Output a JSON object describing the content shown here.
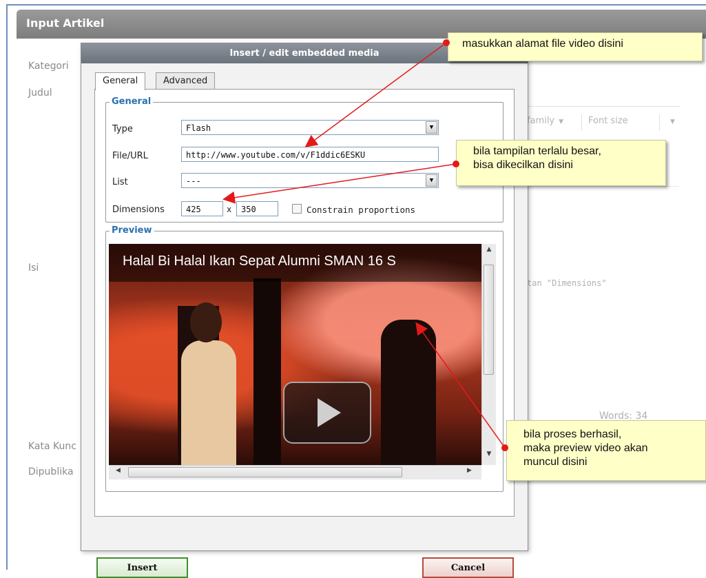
{
  "panel": {
    "title": "Input Artikel"
  },
  "form_labels": {
    "kategori": "Kategori",
    "judul": "Judul",
    "isi": "Isi",
    "kata_kunci": "Kata Kunc",
    "dipublikasi": "Dipublika"
  },
  "editor": {
    "font_family": "family",
    "font_size": "Font size",
    "hint_text": "tan \"Dimensions\"",
    "word_count": "Words: 34"
  },
  "dialog": {
    "title": "Insert / edit embedded media",
    "tabs": [
      {
        "label": "General",
        "active": true
      },
      {
        "label": "Advanced",
        "active": false
      }
    ],
    "general": {
      "legend": "General",
      "type_label": "Type",
      "type_value": "Flash",
      "file_label": "File/URL",
      "file_value": "http://www.youtube.com/v/F1ddic6ESKU",
      "list_label": "List",
      "list_value": "---",
      "dimensions_label": "Dimensions",
      "width_value": "425",
      "times": "x",
      "height_value": "350",
      "constrain_label": "Constrain proportions",
      "constrain_checked": false
    },
    "preview": {
      "legend": "Preview",
      "video_title": "Halal Bi Halal Ikan Sepat Alumni SMAN 16 S"
    },
    "buttons": {
      "insert": "Insert",
      "cancel": "Cancel"
    }
  },
  "annotations": {
    "file_url_note": "masukkan alamat file video disini",
    "dimensions_note": [
      "bila tampilan terlalu besar,",
      "bisa dikecilkan disini"
    ],
    "preview_note": [
      "bila proses berhasil,",
      "maka preview video akan",
      "muncul disini"
    ]
  },
  "colors": {
    "accent": "#2b6fb0",
    "arrow": "#e31a1a",
    "callout_bg": "#ffffc8",
    "insert_border": "#3f8f2e",
    "cancel_border": "#b84a3a"
  }
}
